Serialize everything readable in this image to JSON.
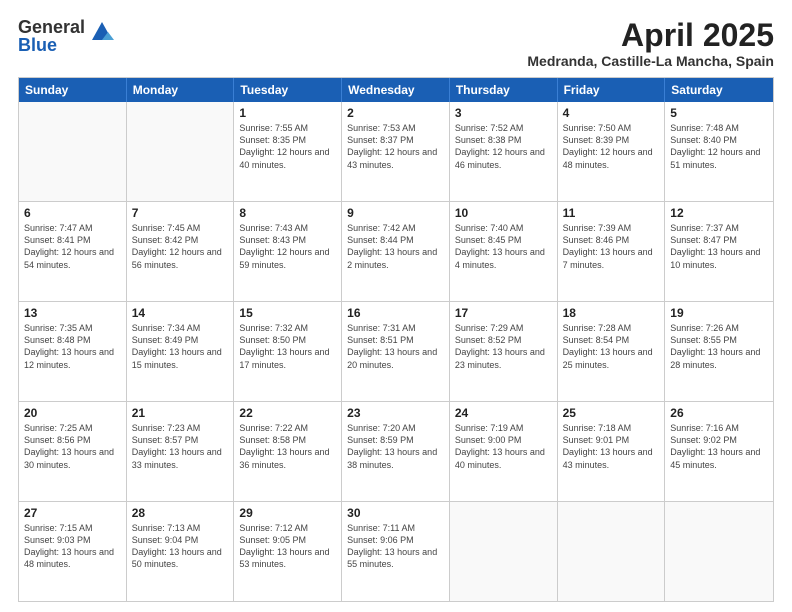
{
  "logo": {
    "general": "General",
    "blue": "Blue"
  },
  "title": "April 2025",
  "location": "Medranda, Castille-La Mancha, Spain",
  "days_of_week": [
    "Sunday",
    "Monday",
    "Tuesday",
    "Wednesday",
    "Thursday",
    "Friday",
    "Saturday"
  ],
  "weeks": [
    [
      {
        "day": "",
        "empty": true
      },
      {
        "day": "",
        "empty": true
      },
      {
        "day": "1",
        "sunrise": "Sunrise: 7:55 AM",
        "sunset": "Sunset: 8:35 PM",
        "daylight": "Daylight: 12 hours and 40 minutes."
      },
      {
        "day": "2",
        "sunrise": "Sunrise: 7:53 AM",
        "sunset": "Sunset: 8:37 PM",
        "daylight": "Daylight: 12 hours and 43 minutes."
      },
      {
        "day": "3",
        "sunrise": "Sunrise: 7:52 AM",
        "sunset": "Sunset: 8:38 PM",
        "daylight": "Daylight: 12 hours and 46 minutes."
      },
      {
        "day": "4",
        "sunrise": "Sunrise: 7:50 AM",
        "sunset": "Sunset: 8:39 PM",
        "daylight": "Daylight: 12 hours and 48 minutes."
      },
      {
        "day": "5",
        "sunrise": "Sunrise: 7:48 AM",
        "sunset": "Sunset: 8:40 PM",
        "daylight": "Daylight: 12 hours and 51 minutes."
      }
    ],
    [
      {
        "day": "6",
        "sunrise": "Sunrise: 7:47 AM",
        "sunset": "Sunset: 8:41 PM",
        "daylight": "Daylight: 12 hours and 54 minutes."
      },
      {
        "day": "7",
        "sunrise": "Sunrise: 7:45 AM",
        "sunset": "Sunset: 8:42 PM",
        "daylight": "Daylight: 12 hours and 56 minutes."
      },
      {
        "day": "8",
        "sunrise": "Sunrise: 7:43 AM",
        "sunset": "Sunset: 8:43 PM",
        "daylight": "Daylight: 12 hours and 59 minutes."
      },
      {
        "day": "9",
        "sunrise": "Sunrise: 7:42 AM",
        "sunset": "Sunset: 8:44 PM",
        "daylight": "Daylight: 13 hours and 2 minutes."
      },
      {
        "day": "10",
        "sunrise": "Sunrise: 7:40 AM",
        "sunset": "Sunset: 8:45 PM",
        "daylight": "Daylight: 13 hours and 4 minutes."
      },
      {
        "day": "11",
        "sunrise": "Sunrise: 7:39 AM",
        "sunset": "Sunset: 8:46 PM",
        "daylight": "Daylight: 13 hours and 7 minutes."
      },
      {
        "day": "12",
        "sunrise": "Sunrise: 7:37 AM",
        "sunset": "Sunset: 8:47 PM",
        "daylight": "Daylight: 13 hours and 10 minutes."
      }
    ],
    [
      {
        "day": "13",
        "sunrise": "Sunrise: 7:35 AM",
        "sunset": "Sunset: 8:48 PM",
        "daylight": "Daylight: 13 hours and 12 minutes."
      },
      {
        "day": "14",
        "sunrise": "Sunrise: 7:34 AM",
        "sunset": "Sunset: 8:49 PM",
        "daylight": "Daylight: 13 hours and 15 minutes."
      },
      {
        "day": "15",
        "sunrise": "Sunrise: 7:32 AM",
        "sunset": "Sunset: 8:50 PM",
        "daylight": "Daylight: 13 hours and 17 minutes."
      },
      {
        "day": "16",
        "sunrise": "Sunrise: 7:31 AM",
        "sunset": "Sunset: 8:51 PM",
        "daylight": "Daylight: 13 hours and 20 minutes."
      },
      {
        "day": "17",
        "sunrise": "Sunrise: 7:29 AM",
        "sunset": "Sunset: 8:52 PM",
        "daylight": "Daylight: 13 hours and 23 minutes."
      },
      {
        "day": "18",
        "sunrise": "Sunrise: 7:28 AM",
        "sunset": "Sunset: 8:54 PM",
        "daylight": "Daylight: 13 hours and 25 minutes."
      },
      {
        "day": "19",
        "sunrise": "Sunrise: 7:26 AM",
        "sunset": "Sunset: 8:55 PM",
        "daylight": "Daylight: 13 hours and 28 minutes."
      }
    ],
    [
      {
        "day": "20",
        "sunrise": "Sunrise: 7:25 AM",
        "sunset": "Sunset: 8:56 PM",
        "daylight": "Daylight: 13 hours and 30 minutes."
      },
      {
        "day": "21",
        "sunrise": "Sunrise: 7:23 AM",
        "sunset": "Sunset: 8:57 PM",
        "daylight": "Daylight: 13 hours and 33 minutes."
      },
      {
        "day": "22",
        "sunrise": "Sunrise: 7:22 AM",
        "sunset": "Sunset: 8:58 PM",
        "daylight": "Daylight: 13 hours and 36 minutes."
      },
      {
        "day": "23",
        "sunrise": "Sunrise: 7:20 AM",
        "sunset": "Sunset: 8:59 PM",
        "daylight": "Daylight: 13 hours and 38 minutes."
      },
      {
        "day": "24",
        "sunrise": "Sunrise: 7:19 AM",
        "sunset": "Sunset: 9:00 PM",
        "daylight": "Daylight: 13 hours and 40 minutes."
      },
      {
        "day": "25",
        "sunrise": "Sunrise: 7:18 AM",
        "sunset": "Sunset: 9:01 PM",
        "daylight": "Daylight: 13 hours and 43 minutes."
      },
      {
        "day": "26",
        "sunrise": "Sunrise: 7:16 AM",
        "sunset": "Sunset: 9:02 PM",
        "daylight": "Daylight: 13 hours and 45 minutes."
      }
    ],
    [
      {
        "day": "27",
        "sunrise": "Sunrise: 7:15 AM",
        "sunset": "Sunset: 9:03 PM",
        "daylight": "Daylight: 13 hours and 48 minutes."
      },
      {
        "day": "28",
        "sunrise": "Sunrise: 7:13 AM",
        "sunset": "Sunset: 9:04 PM",
        "daylight": "Daylight: 13 hours and 50 minutes."
      },
      {
        "day": "29",
        "sunrise": "Sunrise: 7:12 AM",
        "sunset": "Sunset: 9:05 PM",
        "daylight": "Daylight: 13 hours and 53 minutes."
      },
      {
        "day": "30",
        "sunrise": "Sunrise: 7:11 AM",
        "sunset": "Sunset: 9:06 PM",
        "daylight": "Daylight: 13 hours and 55 minutes."
      },
      {
        "day": "",
        "empty": true
      },
      {
        "day": "",
        "empty": true
      },
      {
        "day": "",
        "empty": true
      }
    ]
  ]
}
